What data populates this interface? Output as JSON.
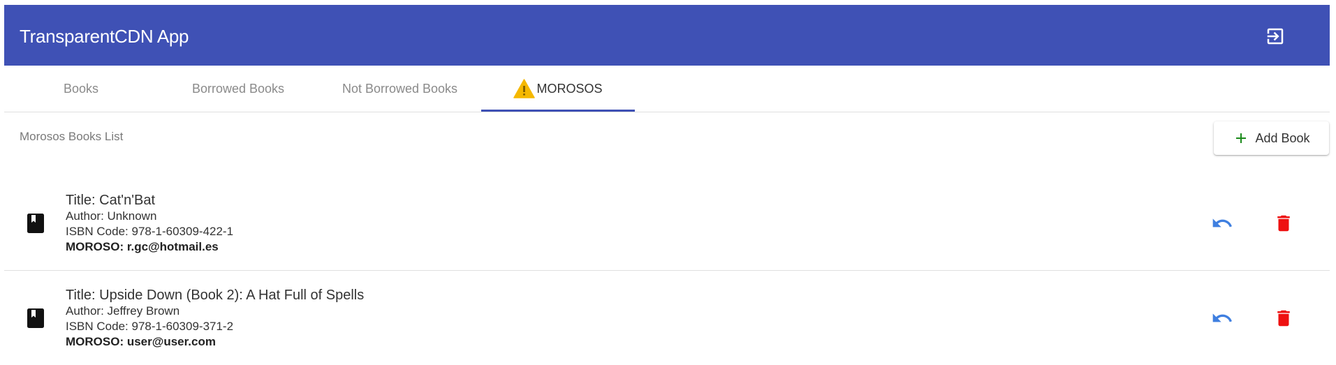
{
  "app": {
    "title": "TransparentCDN App",
    "primary_color": "#3f51b5",
    "logout_icon": "logout-icon"
  },
  "tabs": [
    {
      "label": "Books",
      "active": false
    },
    {
      "label": "Borrowed Books",
      "active": false
    },
    {
      "label": "Not Borrowed Books",
      "active": false
    },
    {
      "label": "MOROSOS",
      "active": true,
      "icon": "warning-icon",
      "icon_color": "#f5b800"
    }
  ],
  "list": {
    "title": "Morosos Books List",
    "add_button": {
      "label": "Add Book",
      "icon": "plus-icon",
      "icon_color": "#1b8a1b"
    }
  },
  "books": [
    {
      "title": "Title: Cat'n'Bat",
      "author": "Author: Unknown",
      "isbn": "ISBN Code: 978-1-60309-422-1",
      "moroso_label": "MOROSO:",
      "moroso_value": "r.gc@hotmail.es"
    },
    {
      "title": "Title: Upside Down (Book 2): A Hat Full of Spells",
      "author": "Author: Jeffrey Brown",
      "isbn": "ISBN Code: 978-1-60309-371-2",
      "moroso_label": "MOROSO:",
      "moroso_value": "user@user.com"
    }
  ],
  "actions": {
    "return_icon": "undo-icon",
    "return_color": "#3f7fe0",
    "delete_icon": "trash-icon",
    "delete_color": "#ee1111"
  }
}
